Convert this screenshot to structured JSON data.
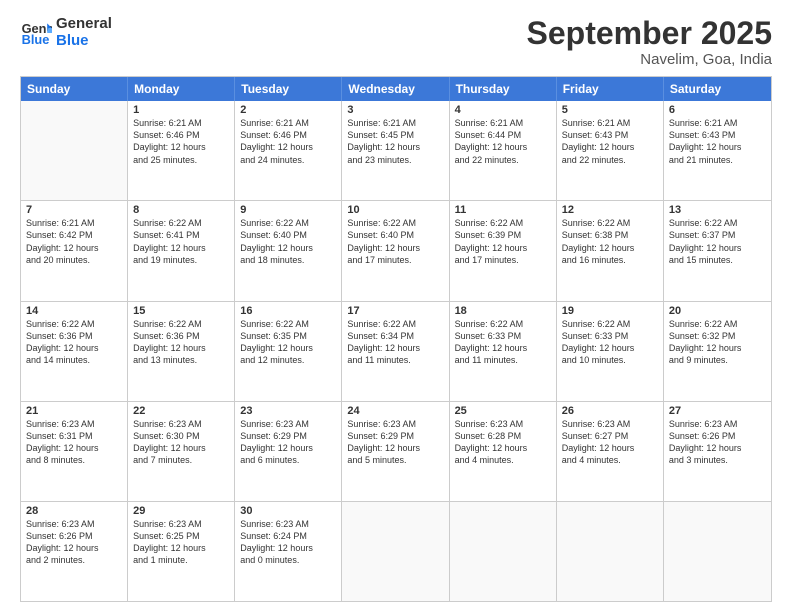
{
  "logo": {
    "line1": "General",
    "line2": "Blue"
  },
  "title": "September 2025",
  "subtitle": "Navelim, Goa, India",
  "days": [
    "Sunday",
    "Monday",
    "Tuesday",
    "Wednesday",
    "Thursday",
    "Friday",
    "Saturday"
  ],
  "rows": [
    [
      {
        "day": "",
        "info": ""
      },
      {
        "day": "1",
        "info": "Sunrise: 6:21 AM\nSunset: 6:46 PM\nDaylight: 12 hours\nand 25 minutes."
      },
      {
        "day": "2",
        "info": "Sunrise: 6:21 AM\nSunset: 6:46 PM\nDaylight: 12 hours\nand 24 minutes."
      },
      {
        "day": "3",
        "info": "Sunrise: 6:21 AM\nSunset: 6:45 PM\nDaylight: 12 hours\nand 23 minutes."
      },
      {
        "day": "4",
        "info": "Sunrise: 6:21 AM\nSunset: 6:44 PM\nDaylight: 12 hours\nand 22 minutes."
      },
      {
        "day": "5",
        "info": "Sunrise: 6:21 AM\nSunset: 6:43 PM\nDaylight: 12 hours\nand 22 minutes."
      },
      {
        "day": "6",
        "info": "Sunrise: 6:21 AM\nSunset: 6:43 PM\nDaylight: 12 hours\nand 21 minutes."
      }
    ],
    [
      {
        "day": "7",
        "info": "Sunrise: 6:21 AM\nSunset: 6:42 PM\nDaylight: 12 hours\nand 20 minutes."
      },
      {
        "day": "8",
        "info": "Sunrise: 6:22 AM\nSunset: 6:41 PM\nDaylight: 12 hours\nand 19 minutes."
      },
      {
        "day": "9",
        "info": "Sunrise: 6:22 AM\nSunset: 6:40 PM\nDaylight: 12 hours\nand 18 minutes."
      },
      {
        "day": "10",
        "info": "Sunrise: 6:22 AM\nSunset: 6:40 PM\nDaylight: 12 hours\nand 17 minutes."
      },
      {
        "day": "11",
        "info": "Sunrise: 6:22 AM\nSunset: 6:39 PM\nDaylight: 12 hours\nand 17 minutes."
      },
      {
        "day": "12",
        "info": "Sunrise: 6:22 AM\nSunset: 6:38 PM\nDaylight: 12 hours\nand 16 minutes."
      },
      {
        "day": "13",
        "info": "Sunrise: 6:22 AM\nSunset: 6:37 PM\nDaylight: 12 hours\nand 15 minutes."
      }
    ],
    [
      {
        "day": "14",
        "info": "Sunrise: 6:22 AM\nSunset: 6:36 PM\nDaylight: 12 hours\nand 14 minutes."
      },
      {
        "day": "15",
        "info": "Sunrise: 6:22 AM\nSunset: 6:36 PM\nDaylight: 12 hours\nand 13 minutes."
      },
      {
        "day": "16",
        "info": "Sunrise: 6:22 AM\nSunset: 6:35 PM\nDaylight: 12 hours\nand 12 minutes."
      },
      {
        "day": "17",
        "info": "Sunrise: 6:22 AM\nSunset: 6:34 PM\nDaylight: 12 hours\nand 11 minutes."
      },
      {
        "day": "18",
        "info": "Sunrise: 6:22 AM\nSunset: 6:33 PM\nDaylight: 12 hours\nand 11 minutes."
      },
      {
        "day": "19",
        "info": "Sunrise: 6:22 AM\nSunset: 6:33 PM\nDaylight: 12 hours\nand 10 minutes."
      },
      {
        "day": "20",
        "info": "Sunrise: 6:22 AM\nSunset: 6:32 PM\nDaylight: 12 hours\nand 9 minutes."
      }
    ],
    [
      {
        "day": "21",
        "info": "Sunrise: 6:23 AM\nSunset: 6:31 PM\nDaylight: 12 hours\nand 8 minutes."
      },
      {
        "day": "22",
        "info": "Sunrise: 6:23 AM\nSunset: 6:30 PM\nDaylight: 12 hours\nand 7 minutes."
      },
      {
        "day": "23",
        "info": "Sunrise: 6:23 AM\nSunset: 6:29 PM\nDaylight: 12 hours\nand 6 minutes."
      },
      {
        "day": "24",
        "info": "Sunrise: 6:23 AM\nSunset: 6:29 PM\nDaylight: 12 hours\nand 5 minutes."
      },
      {
        "day": "25",
        "info": "Sunrise: 6:23 AM\nSunset: 6:28 PM\nDaylight: 12 hours\nand 4 minutes."
      },
      {
        "day": "26",
        "info": "Sunrise: 6:23 AM\nSunset: 6:27 PM\nDaylight: 12 hours\nand 4 minutes."
      },
      {
        "day": "27",
        "info": "Sunrise: 6:23 AM\nSunset: 6:26 PM\nDaylight: 12 hours\nand 3 minutes."
      }
    ],
    [
      {
        "day": "28",
        "info": "Sunrise: 6:23 AM\nSunset: 6:26 PM\nDaylight: 12 hours\nand 2 minutes."
      },
      {
        "day": "29",
        "info": "Sunrise: 6:23 AM\nSunset: 6:25 PM\nDaylight: 12 hours\nand 1 minute."
      },
      {
        "day": "30",
        "info": "Sunrise: 6:23 AM\nSunset: 6:24 PM\nDaylight: 12 hours\nand 0 minutes."
      },
      {
        "day": "",
        "info": ""
      },
      {
        "day": "",
        "info": ""
      },
      {
        "day": "",
        "info": ""
      },
      {
        "day": "",
        "info": ""
      }
    ]
  ]
}
